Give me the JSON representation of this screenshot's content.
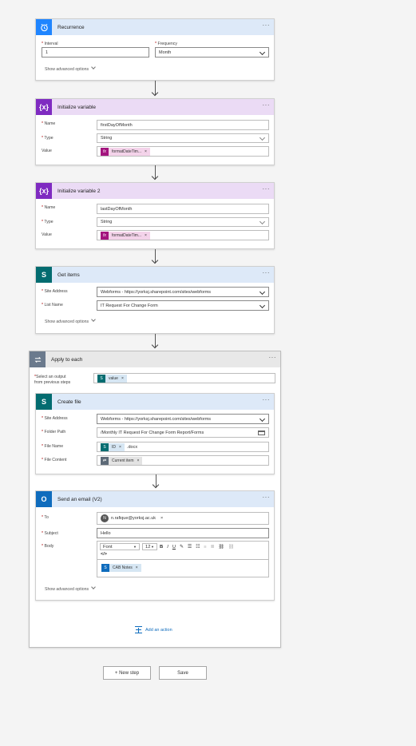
{
  "recurrence": {
    "title": "Recurrence",
    "interval_label": "Interval",
    "interval_value": "1",
    "frequency_label": "Frequency",
    "frequency_value": "Month",
    "advanced": "Show advanced options"
  },
  "init_var1": {
    "title": "Initialize variable",
    "name_label": "Name",
    "name_value": "firstDayOfMonth",
    "type_label": "Type",
    "type_value": "String",
    "value_label": "Value",
    "value_token": "formatDateTim..."
  },
  "init_var2": {
    "title": "Initialize variable 2",
    "name_label": "Name",
    "name_value": "lastDayOfMonth",
    "type_label": "Type",
    "type_value": "String",
    "value_label": "Value",
    "value_token": "formatDateTim..."
  },
  "get_items": {
    "title": "Get items",
    "site_label": "Site Address",
    "site_value": "Webforms - https://yorksj.sharepoint.com/sites/webforms",
    "list_label": "List Name",
    "list_value": "IT Request For Change Form",
    "advanced": "Show advanced options"
  },
  "apply_each": {
    "title": "Apply to each",
    "select_label_1": "Select an output",
    "select_label_2": "from previous steps",
    "token": "value",
    "add_action": "Add an action"
  },
  "create_file": {
    "title": "Create file",
    "site_label": "Site Address",
    "site_value": "Webforms - https://yorksj.sharepoint.com/sites/webforms",
    "folder_label": "Folder Path",
    "folder_value": "/Monthly IT Request For Change Form Report/Forms",
    "filename_label": "File Name",
    "filename_token": "ID",
    "filename_suffix": ".docx",
    "content_label": "File Content",
    "content_token": "Current item"
  },
  "send_email": {
    "title": "Send an email (V2)",
    "to_label": "To",
    "to_avatar": "N",
    "to_value": "n.rafique@yorksj.ac.uk",
    "subject_label": "Subject",
    "subject_value": "Hello",
    "body_label": "Body",
    "font_value": "Font",
    "size_value": "12",
    "body_token": "CAB Notes",
    "advanced": "Show advanced options"
  },
  "footer": {
    "new_step": "+ New step",
    "save": "Save"
  },
  "common": {
    "dots": "···",
    "remove": "×",
    "code_view": "</>"
  },
  "colors": {
    "recurrence": "#1f85ff",
    "variable": "#7f2bc1",
    "sharepoint": "#036c70",
    "outlook": "#0f6cbd",
    "control": "#6b7a8d"
  }
}
